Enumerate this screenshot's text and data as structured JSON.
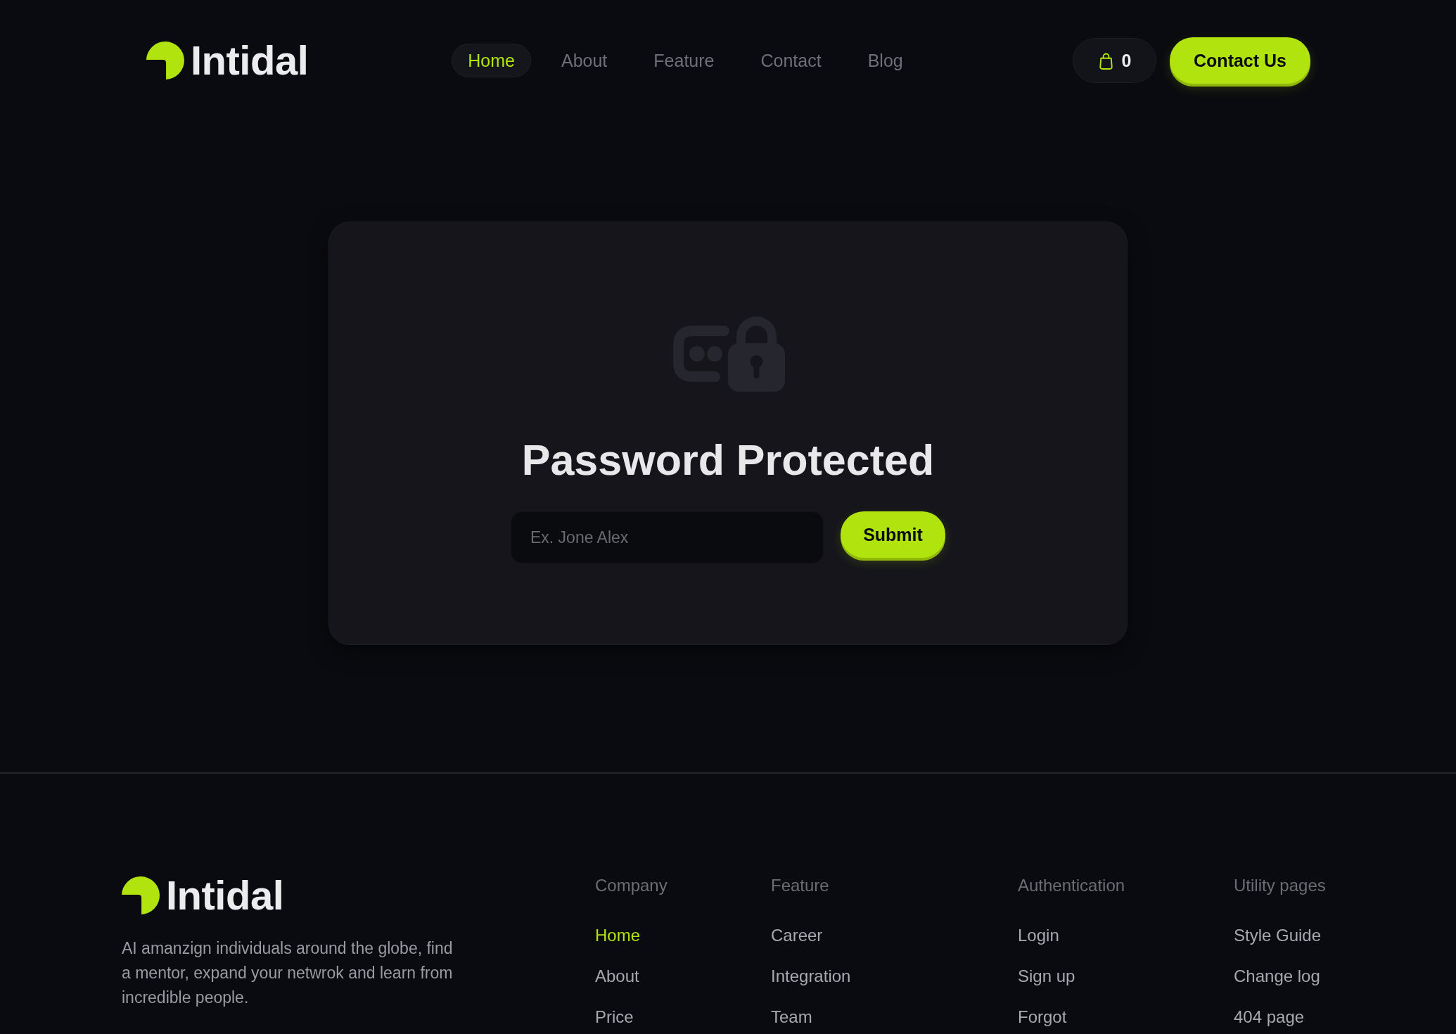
{
  "header": {
    "logo": {
      "text": "Intidal"
    },
    "nav": [
      {
        "label": "Home",
        "selected": true
      },
      {
        "label": "About",
        "selected": false
      },
      {
        "label": "Feature",
        "selected": false
      },
      {
        "label": "Contact",
        "selected": false
      },
      {
        "label": "Blog",
        "selected": false
      }
    ],
    "cart": {
      "count": "0"
    },
    "cta": "Contact Us"
  },
  "card": {
    "title": "Password Protected",
    "input": {
      "placeholder": "Ex. Jone Alex"
    },
    "button": "Submit"
  },
  "footer": {
    "logo": {
      "text": "Intidal"
    },
    "description": "AI amanzign individuals around the globe, find a mentor, expand your netwrok and learn from incredible people.",
    "columns": [
      {
        "title": "Company",
        "links": [
          {
            "label": "Home",
            "selected": true
          },
          {
            "label": "About",
            "selected": false
          },
          {
            "label": "Price",
            "selected": false
          }
        ]
      },
      {
        "title": "Feature",
        "links": [
          {
            "label": "Career",
            "selected": false
          },
          {
            "label": "Integration",
            "selected": false
          },
          {
            "label": "Team",
            "selected": false
          }
        ]
      },
      {
        "title": "Authentication",
        "links": [
          {
            "label": "Login",
            "selected": false
          },
          {
            "label": "Sign up",
            "selected": false
          },
          {
            "label": "Forgot",
            "selected": false
          }
        ]
      },
      {
        "title": "Utility pages",
        "links": [
          {
            "label": "Style Guide",
            "selected": false
          },
          {
            "label": "Change log",
            "selected": false
          },
          {
            "label": "404 page",
            "selected": false
          }
        ]
      }
    ]
  }
}
